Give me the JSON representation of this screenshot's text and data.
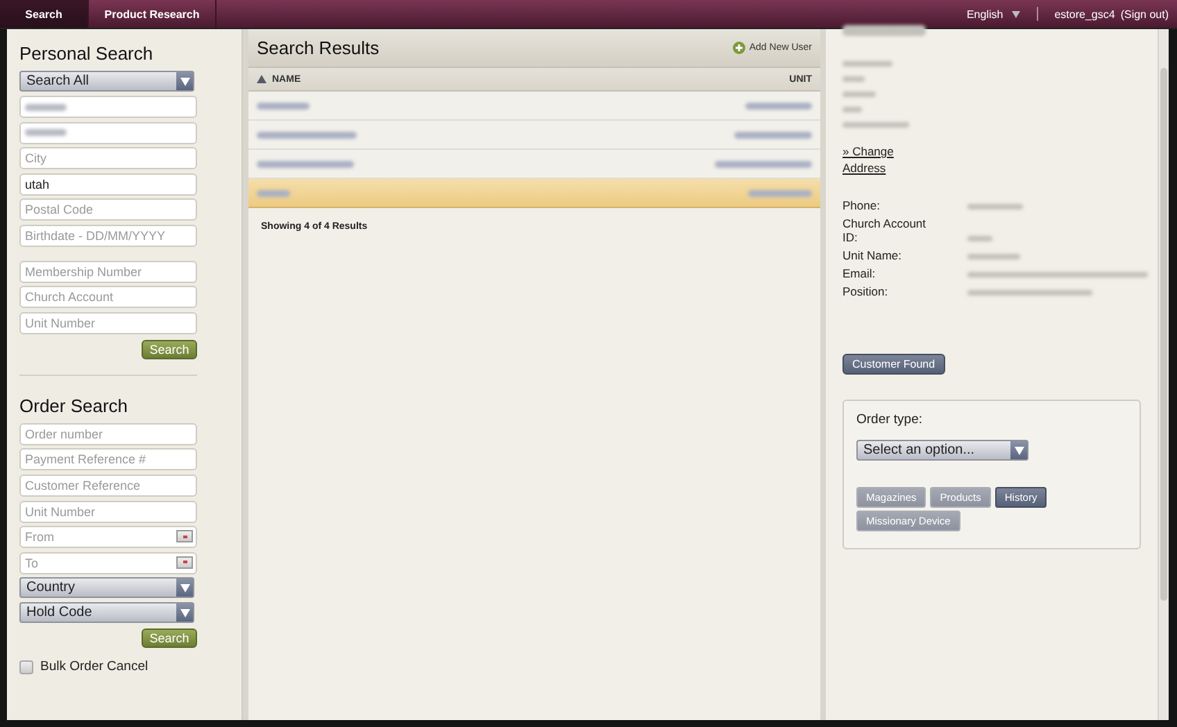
{
  "nav": {
    "tabs": [
      {
        "label": "Search",
        "selected": true
      },
      {
        "label": "Product Research",
        "selected": false
      }
    ],
    "language": "English",
    "user": "estore_gsc4",
    "sign_out": "(Sign out)"
  },
  "personal_search": {
    "title": "Personal Search",
    "scope": "Search All",
    "fields": [
      {
        "kind": "redacted"
      },
      {
        "kind": "redacted"
      },
      {
        "kind": "text",
        "placeholder": "City"
      },
      {
        "kind": "text",
        "value": "utah"
      },
      {
        "kind": "text",
        "placeholder": "Postal Code"
      },
      {
        "kind": "text",
        "placeholder": "Birthdate - DD/MM/YYYY"
      }
    ],
    "id_fields": [
      {
        "kind": "text",
        "placeholder": "Membership Number"
      },
      {
        "kind": "text",
        "placeholder": "Church Account"
      },
      {
        "kind": "text",
        "placeholder": "Unit Number"
      }
    ],
    "button": "Search"
  },
  "order_search": {
    "title": "Order Search",
    "fields": [
      {
        "kind": "text",
        "placeholder": "Order number"
      },
      {
        "kind": "text",
        "placeholder": "Payment Reference #"
      },
      {
        "kind": "text",
        "placeholder": "Customer Reference"
      },
      {
        "kind": "text",
        "placeholder": "Unit Number"
      },
      {
        "kind": "date",
        "placeholder": "From"
      },
      {
        "kind": "date",
        "placeholder": "To"
      },
      {
        "kind": "select",
        "value": "Country"
      },
      {
        "kind": "select",
        "value": "Hold Code"
      }
    ],
    "button": "Search",
    "bulk_cancel": {
      "label": "Bulk Order Cancel",
      "checked": false
    }
  },
  "results": {
    "title": "Search Results",
    "add_user": "Add New User",
    "columns": [
      {
        "label": "NAME",
        "sorted": true
      },
      {
        "label": "UNIT",
        "sorted": false
      }
    ],
    "rows": [
      {
        "selected": false
      },
      {
        "selected": false
      },
      {
        "selected": false
      },
      {
        "selected": true
      }
    ],
    "summary": "Showing 4 of 4 Results"
  },
  "customer": {
    "change_address": "» Change Address",
    "details": [
      {
        "label": "Phone:"
      },
      {
        "label": "Church Account ID:"
      },
      {
        "label": "Unit Name:"
      },
      {
        "label": "Email:"
      },
      {
        "label": "Position:"
      }
    ],
    "found_button": "Customer Found",
    "order": {
      "label": "Order type:",
      "select": "Select an option...",
      "types": [
        {
          "label": "Magazines",
          "selected": false
        },
        {
          "label": "Products",
          "selected": false
        },
        {
          "label": "History",
          "selected": true
        },
        {
          "label": "Missionary Device",
          "selected": false
        }
      ]
    }
  }
}
